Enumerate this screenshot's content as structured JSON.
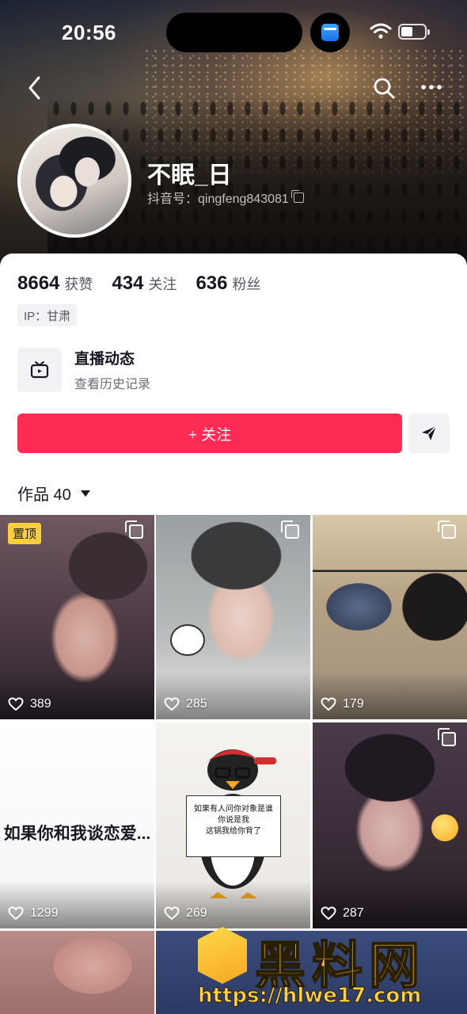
{
  "status_bar": {
    "time": "20:56"
  },
  "profile": {
    "nickname": "不眠_日",
    "douyin_id": "抖音号：qingfeng843081",
    "stats": [
      {
        "num": "8664",
        "label": "获赞"
      },
      {
        "num": "434",
        "label": "关注"
      },
      {
        "num": "636",
        "label": "粉丝"
      }
    ],
    "ip": "IP：甘肃"
  },
  "live": {
    "title": "直播动态",
    "subtitle": "查看历史记录"
  },
  "actions": {
    "follow_label": "+ 关注"
  },
  "works": {
    "tab_label": "作品 40"
  },
  "grid": {
    "pinned_label": "置顶",
    "tiles": [
      {
        "likes": "389"
      },
      {
        "likes": "285"
      },
      {
        "likes": "179"
      },
      {
        "likes": "1299",
        "text": "如果你和我谈恋爱..."
      },
      {
        "likes": "269",
        "sign_lines": [
          "如果有人问你对象是谁",
          "你说是我",
          "这锅我给你背了"
        ]
      },
      {
        "likes": "287"
      }
    ]
  },
  "watermark": {
    "title": "黑料网",
    "url": "https://hlwe17.com"
  },
  "colors": {
    "accent": "#fe2c55",
    "pin_badge": "#facd3c"
  }
}
